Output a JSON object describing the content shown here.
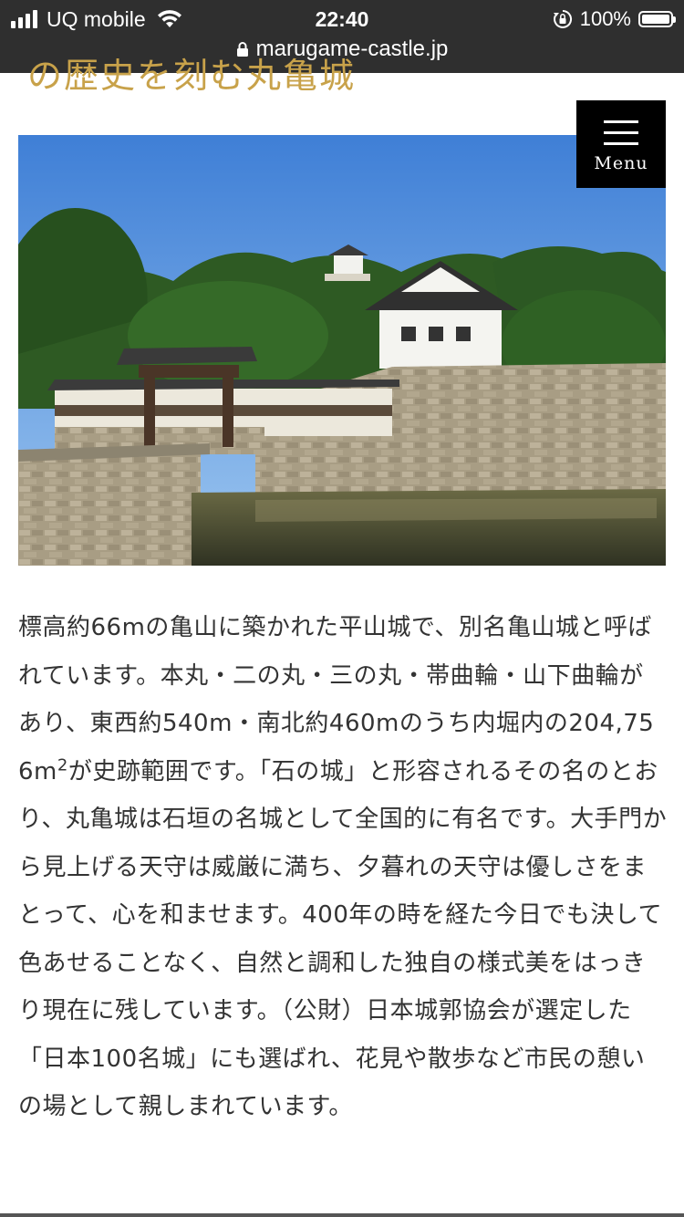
{
  "status_bar": {
    "carrier": "UQ mobile",
    "time": "22:40",
    "battery": "100%",
    "url": "marugame-castle.jp"
  },
  "page": {
    "heading_partial": "の歴史を刻む丸亀城",
    "menu_label": "Menu",
    "hero_image_alt": "丸亀城 大手門と天守",
    "description_part1": "標高約66mの亀山に築かれた平山城で、別名亀山城と呼ばれています。本丸・二の丸・三の丸・帯曲輪・山下曲輪があり、東西約540m・南北約460mのうち内堀内の204,756m",
    "description_sup": "2",
    "description_part2": "が史跡範囲です。「石の城」と形容されるその名のとおり、丸亀城は石垣の名城として全国的に有名です。大手門から見上げる天守は威厳に満ち、夕暮れの天守は優しさをまとって、心を和ませます。400年の時を経た今日でも決して色あせることなく、自然と調和した独自の様式美をはっきり現在に残しています。（公財）日本城郭協会が選定した「日本100名城」にも選ばれ、花見や散歩など市民の憩いの場として親しまれています。"
  },
  "icons": [
    "signal-icon",
    "wifi-icon",
    "rotation-lock-icon",
    "battery-icon",
    "padlock-icon",
    "hamburger-icon"
  ],
  "colors": {
    "status_bar_bg": "#2f2f2f",
    "heading_gold": "#c8a24a",
    "menu_bg": "#000000",
    "body_text": "#333333"
  }
}
